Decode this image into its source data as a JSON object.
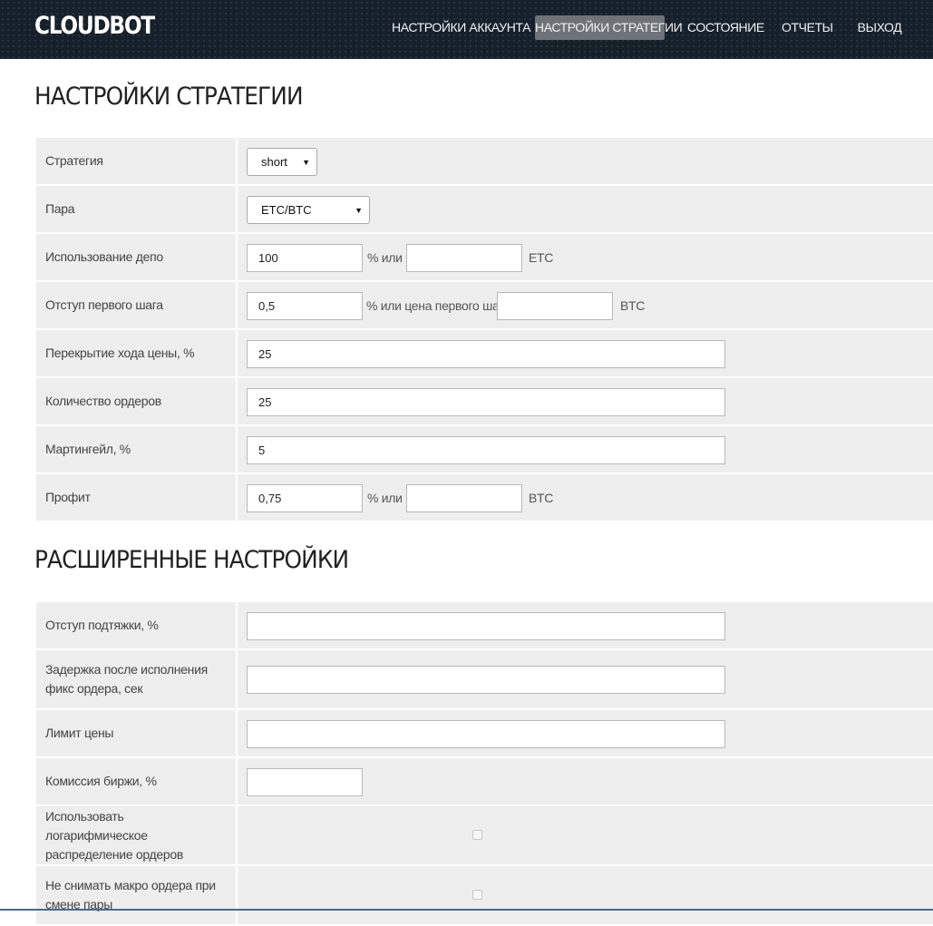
{
  "header": {
    "logo": "CLOUDBOT",
    "nav": [
      {
        "label": "НАСТРОЙКИ АККАУНТА"
      },
      {
        "label": "НАСТРОЙКИ СТРАТЕГИИ",
        "active": true
      },
      {
        "label": "СОСТОЯНИЕ"
      },
      {
        "label": "ОТЧЕТЫ"
      },
      {
        "label": "ВЫХОД"
      }
    ]
  },
  "strategy": {
    "title": "НАСТРОЙКИ СТРАТЕГИИ",
    "strategy_label": "Стратегия",
    "strategy_value": "short",
    "pair_label": "Пара",
    "pair_value": "ETC/BTC",
    "deposit_label": "Использование депо",
    "deposit_value": "100",
    "deposit_unit": "%  или",
    "deposit_alt_value": "",
    "deposit_currency": "ETC",
    "first_step_label": "Отступ первого шага",
    "first_step_value": "0,5",
    "first_step_unit": "% или цена первого шага",
    "first_step_price": "",
    "first_step_currency": "BTC",
    "overlap_label": "Перекрытие хода цены, %",
    "overlap_value": "25",
    "orders_label": "Количество ордеров",
    "orders_value": "25",
    "martingale_label": "Мартингейл, %",
    "martingale_value": "5",
    "profit_label": "Профит",
    "profit_value": "0,75",
    "profit_unit": "%  или",
    "profit_alt_value": "",
    "profit_currency": "BTC"
  },
  "advanced": {
    "title": "РАСШИРЕННЫЕ НАСТРОЙКИ",
    "pullback_label": "Отступ подтяжки, %",
    "pullback_value": "",
    "delay_label": "Задержка после исполнения фикс ордера, сек",
    "delay_value": "",
    "price_limit_label": "Лимит цены",
    "price_limit_value": "",
    "commission_label": "Комиссия биржи, %",
    "commission_value": "",
    "log_dist_label": "Использовать логарифмическое распределение ордеров",
    "log_dist_checked": false,
    "keep_macro_label": "Не снимать макро ордера при смене пары",
    "keep_macro_checked": false
  }
}
